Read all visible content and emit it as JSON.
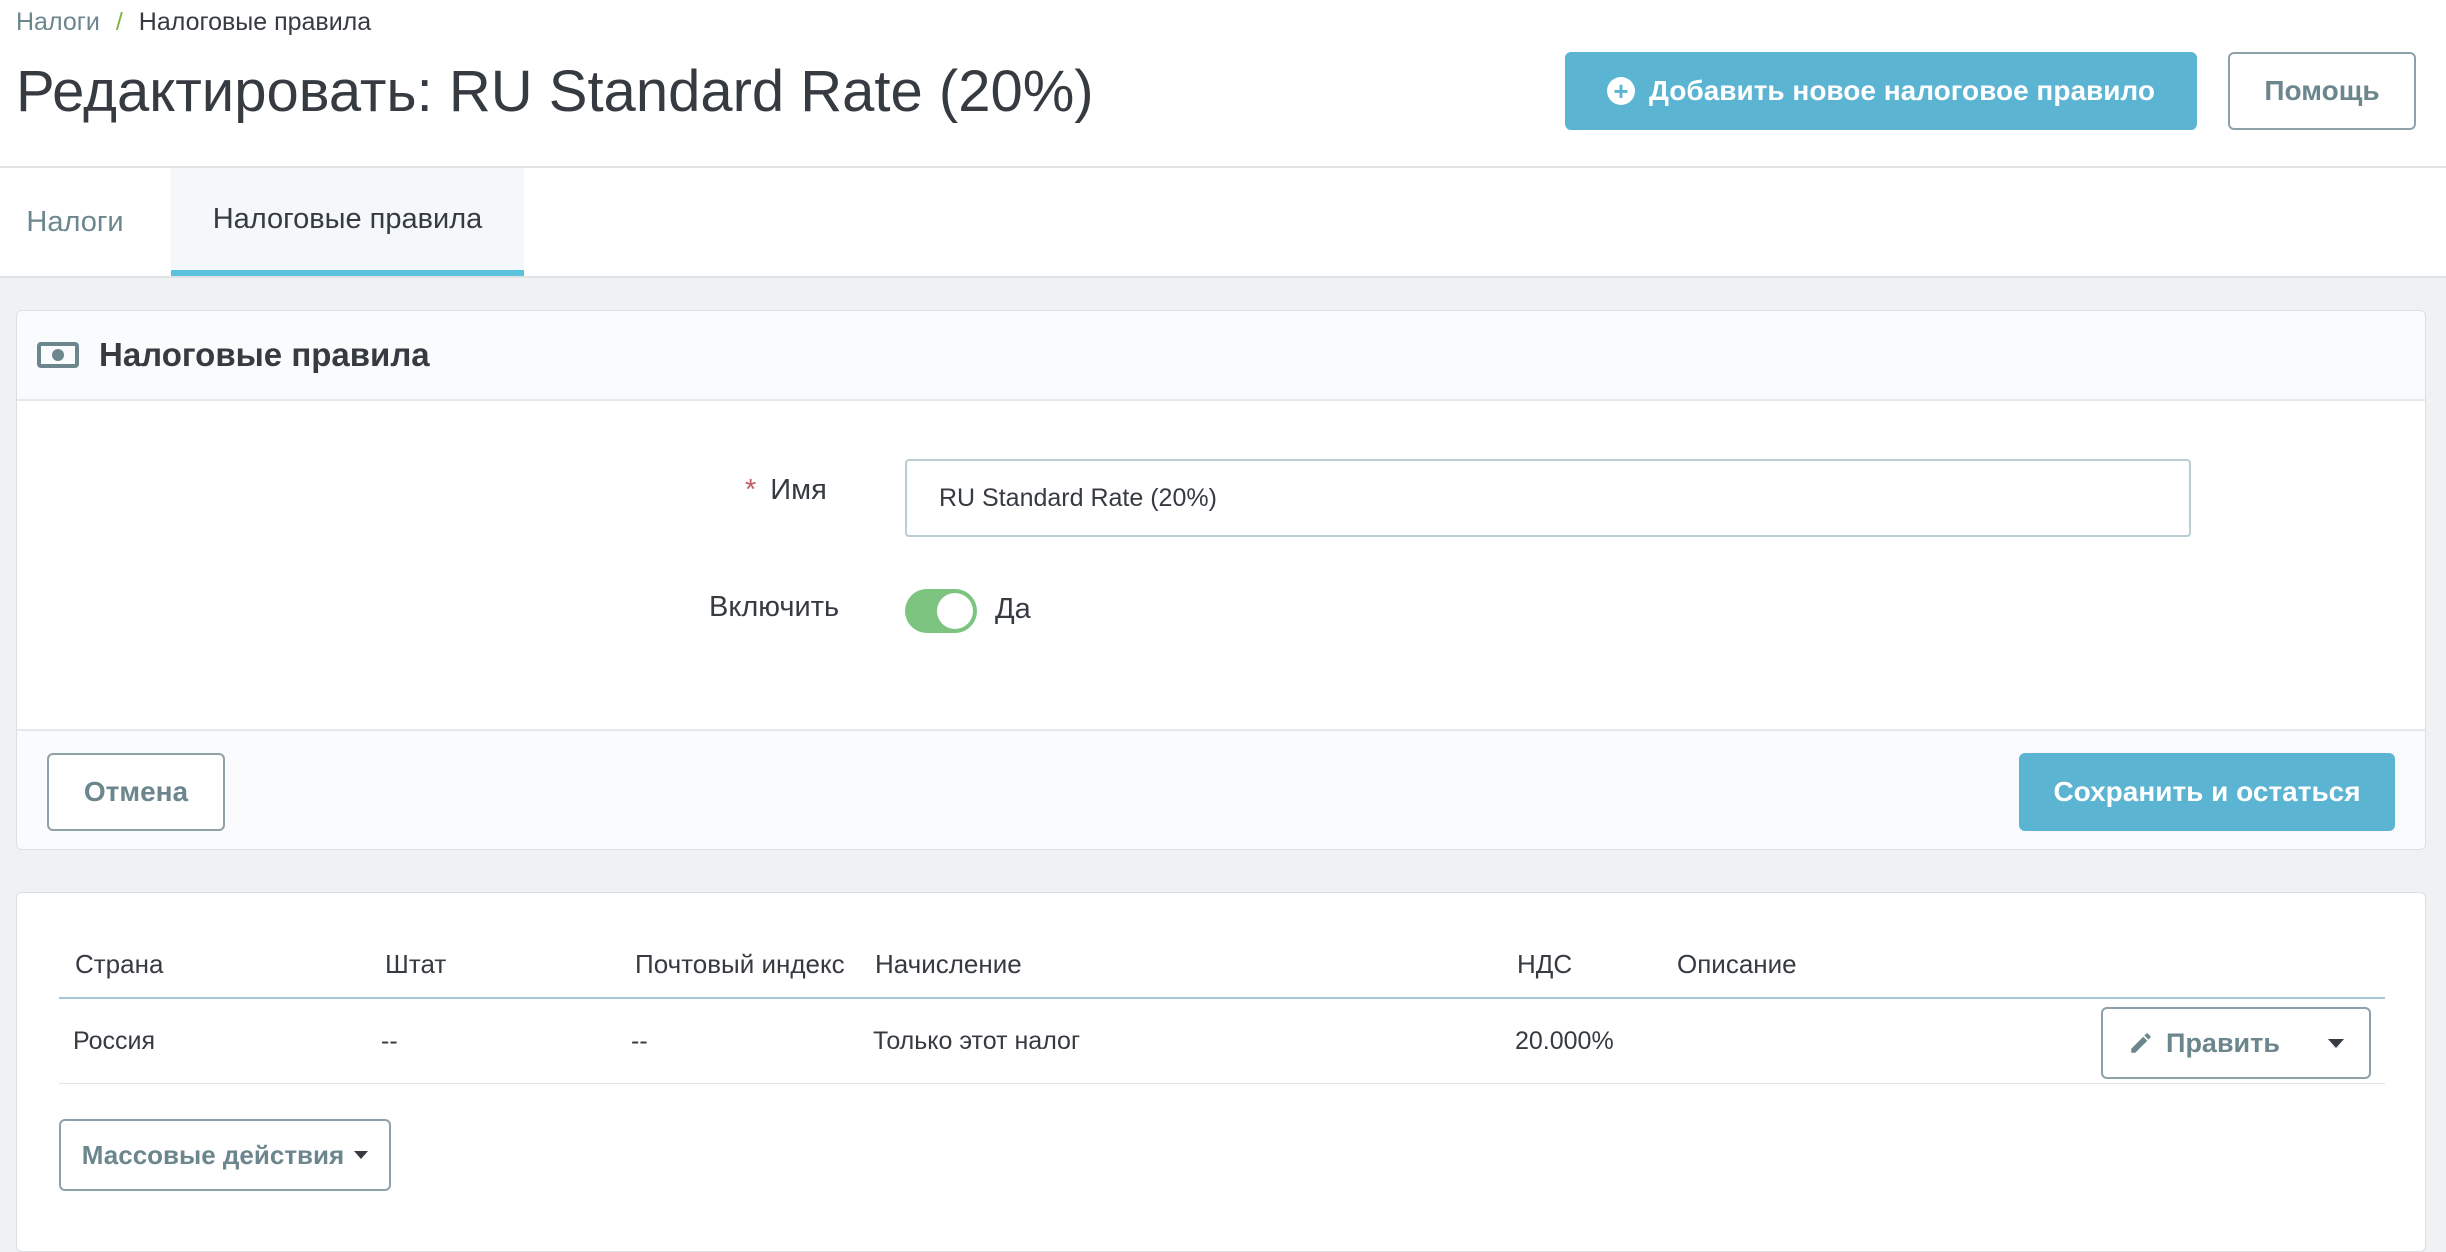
{
  "breadcrumb": {
    "parent": "Налоги",
    "separator": "/",
    "current": "Налоговые правила"
  },
  "page": {
    "title": "Редактировать: RU Standard Rate (20%)"
  },
  "toolbar": {
    "add_label": "Добавить новое налоговое правило",
    "help_label": "Помощь"
  },
  "tabs": [
    {
      "label": "Налоги",
      "active": false
    },
    {
      "label": "Налоговые правила",
      "active": true
    }
  ],
  "form": {
    "panel_title": "Налоговые правила",
    "name_label": "Имя",
    "required_marker": "*",
    "name_value": "RU Standard Rate (20%)",
    "enable_label": "Включить",
    "enable_state": "Да",
    "cancel_label": "Отмена",
    "save_label": "Сохранить и остаться"
  },
  "table": {
    "columns": [
      "Страна",
      "Штат",
      "Почтовый индекс",
      "Начисление",
      "НДС",
      "Описание"
    ],
    "rows": [
      {
        "country": "Россия",
        "state": "--",
        "zip": "--",
        "behavior": "Только этот налог",
        "tax": "20.000%",
        "description": ""
      }
    ],
    "edit_label": "Править",
    "bulk_label": "Массовые действия"
  },
  "colors": {
    "primary": "#5bb4d2",
    "tab_active_border": "#5bc2de",
    "switch_on": "#7cc47f",
    "required": "#c05c67",
    "breadcrumb_separator": "#7cb342"
  },
  "icons": [
    "plus-circle-icon",
    "money-icon",
    "pencil-icon",
    "caret-down-icon"
  ]
}
